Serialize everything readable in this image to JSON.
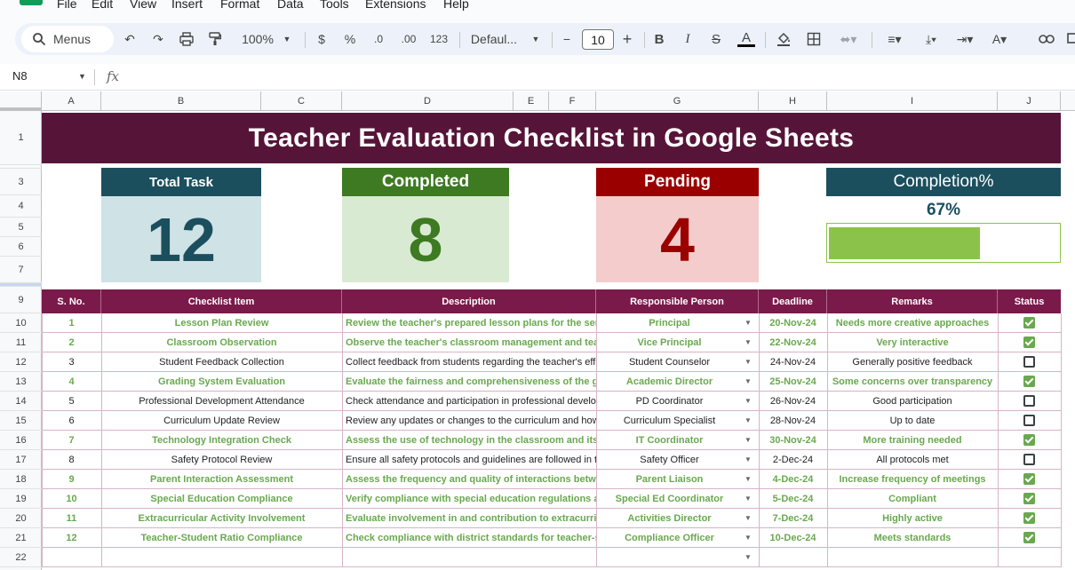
{
  "menu": [
    "File",
    "Edit",
    "View",
    "Insert",
    "Format",
    "Data",
    "Tools",
    "Extensions",
    "Help"
  ],
  "toolbar": {
    "menus_label": "Menus",
    "zoom": "100%",
    "currency": "$",
    "percent": "%",
    "dec_less": ".0",
    "dec_more": ".00",
    "number_format": "123",
    "font": "Defaul...",
    "font_size": "10"
  },
  "formula_bar": {
    "name_box": "N8",
    "fx": "fx"
  },
  "columns": [
    "A",
    "B",
    "C",
    "D",
    "E",
    "F",
    "G",
    "H",
    "I",
    "J"
  ],
  "rows": [
    "1",
    "3",
    "4",
    "5",
    "6",
    "7",
    "9",
    "10",
    "11",
    "12",
    "13",
    "14",
    "15",
    "16",
    "17",
    "18",
    "19",
    "20",
    "21",
    "22"
  ],
  "title": "Teacher Evaluation Checklist in Google Sheets",
  "kpis": {
    "total": {
      "label": "Total Task",
      "value": "12",
      "header_color": "#1b4f5e",
      "body_color": "#cfe2e6",
      "value_color": "#1b4f5e"
    },
    "completed": {
      "label": "Completed",
      "value": "8",
      "header_color": "#3d7a22",
      "body_color": "#d9ead3",
      "value_color": "#3d7a22"
    },
    "pending": {
      "label": "Pending",
      "value": "4",
      "header_color": "#9b0000",
      "body_color": "#f4cccc",
      "value_color": "#9b0000"
    },
    "completion": {
      "label": "Completion%",
      "value": "67%",
      "fraction": 0.67,
      "header_color": "#1b4f5e"
    }
  },
  "table": {
    "headers": [
      "S. No.",
      "Checklist Item",
      "Description",
      "Responsible Person",
      "Deadline",
      "Remarks",
      "Status"
    ],
    "rows": [
      {
        "sno": "1",
        "item": "Lesson Plan Review",
        "desc": "Review the teacher's prepared lesson plans for the ser",
        "person": "Principal",
        "deadline": "20-Nov-24",
        "remarks": "Needs more creative approaches",
        "done": true
      },
      {
        "sno": "2",
        "item": "Classroom Observation",
        "desc": "Observe the teacher's classroom management and tea",
        "person": "Vice Principal",
        "deadline": "22-Nov-24",
        "remarks": "Very interactive",
        "done": true
      },
      {
        "sno": "3",
        "item": "Student Feedback Collection",
        "desc": "Collect feedback from students regarding the teacher's effe",
        "person": "Student Counselor",
        "deadline": "24-Nov-24",
        "remarks": "Generally positive feedback",
        "done": false
      },
      {
        "sno": "4",
        "item": "Grading System Evaluation",
        "desc": "Evaluate the fairness and comprehensiveness of the g",
        "person": "Academic Director",
        "deadline": "25-Nov-24",
        "remarks": "Some concerns over transparency",
        "done": true
      },
      {
        "sno": "5",
        "item": "Professional Development Attendance",
        "desc": "Check attendance and participation in professional develop",
        "person": "PD Coordinator",
        "deadline": "26-Nov-24",
        "remarks": "Good participation",
        "done": false
      },
      {
        "sno": "6",
        "item": "Curriculum Update Review",
        "desc": "Review any updates or changes to the curriculum and how",
        "person": "Curriculum Specialist",
        "deadline": "28-Nov-24",
        "remarks": "Up to date",
        "done": false
      },
      {
        "sno": "7",
        "item": "Technology Integration Check",
        "desc": "Assess the use of technology in the classroom and its",
        "person": "IT Coordinator",
        "deadline": "30-Nov-24",
        "remarks": "More training needed",
        "done": true
      },
      {
        "sno": "8",
        "item": "Safety Protocol Review",
        "desc": "Ensure all safety protocols and guidelines are followed in t",
        "person": "Safety Officer",
        "deadline": "2-Dec-24",
        "remarks": "All protocols met",
        "done": false
      },
      {
        "sno": "9",
        "item": "Parent Interaction Assessment",
        "desc": "Assess the frequency and quality of interactions betw",
        "person": "Parent Liaison",
        "deadline": "4-Dec-24",
        "remarks": "Increase frequency of meetings",
        "done": true
      },
      {
        "sno": "10",
        "item": "Special Education Compliance",
        "desc": "Verify compliance with special education regulations a",
        "person": "Special Ed Coordinator",
        "deadline": "5-Dec-24",
        "remarks": "Compliant",
        "done": true
      },
      {
        "sno": "11",
        "item": "Extracurricular Activity Involvement",
        "desc": "Evaluate involvement in and contribution to extracurri",
        "person": "Activities Director",
        "deadline": "7-Dec-24",
        "remarks": "Highly active",
        "done": true
      },
      {
        "sno": "12",
        "item": "Teacher-Student Ratio Compliance",
        "desc": "Check compliance with district standards for teacher-s",
        "person": "Compliance Officer",
        "deadline": "10-Dec-24",
        "remarks": "Meets standards",
        "done": true
      }
    ]
  }
}
